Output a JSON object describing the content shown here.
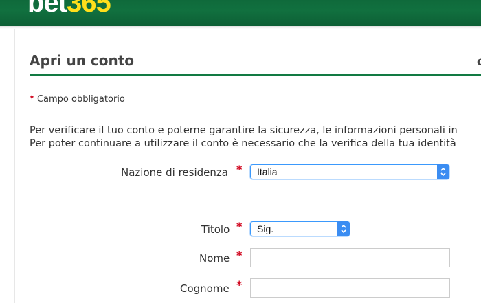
{
  "header": {
    "logo_part1": "bet",
    "logo_part2": "365"
  },
  "page": {
    "title": "Apri un conto",
    "title_right_fragment": "c"
  },
  "required_note": {
    "star": "*",
    "text": "Campo obbligatorio"
  },
  "info": {
    "line1": "Per verificare il tuo conto e poterne garantire la sicurezza, le informazioni personali in",
    "line2": "Per poter continuare a utilizzare il conto è necessario che la verifica della tua identità"
  },
  "form": {
    "required_star": "*",
    "nazione": {
      "label": "Nazione di residenza",
      "value": "Italia"
    },
    "titolo": {
      "label": "Titolo",
      "value": "Sig."
    },
    "nome": {
      "label": "Nome",
      "value": ""
    },
    "cognome": {
      "label": "Cognome",
      "value": ""
    }
  },
  "colors": {
    "brand_green": "#127a43",
    "brand_yellow": "#ffdf1b",
    "required_red": "#d0021b",
    "select_blue": "#3b8df2"
  },
  "icons": {
    "select_arrows": "chevron-up-down-icon"
  }
}
